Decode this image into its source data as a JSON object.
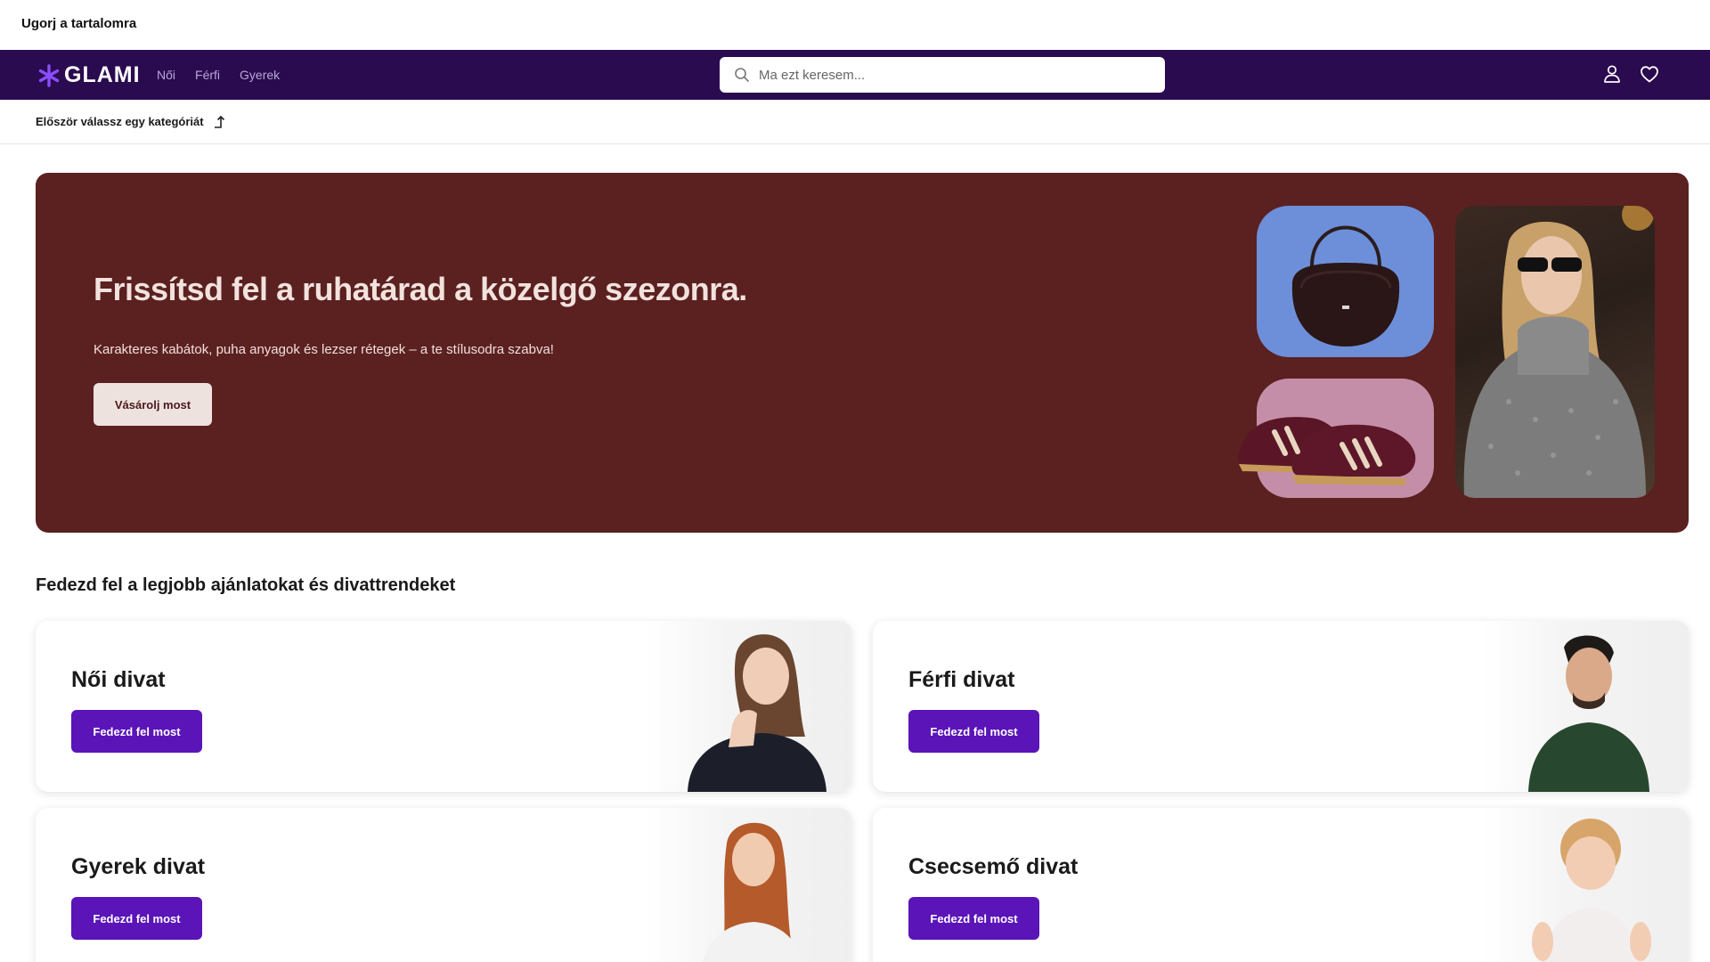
{
  "skip_link": "Ugorj a tartalomra",
  "header": {
    "logo_text": "GLAMI",
    "nav": [
      "Női",
      "Férfi",
      "Gyerek"
    ],
    "search_placeholder": "Ma ezt keresem..."
  },
  "catbar": {
    "label": "Először válassz egy kategóriát"
  },
  "hero": {
    "title": "Frissítsd fel a ruhatárad a közelgő szezonra.",
    "subtitle": "Karakteres kabátok, puha anyagok és lezser rétegek – a te stílusodra szabva!",
    "button": "Vásárolj most"
  },
  "section_title": "Fedezd fel a legjobb ajánlatokat és divattrendeket",
  "cards": [
    {
      "title": "Női divat",
      "button": "Fedezd fel most"
    },
    {
      "title": "Férfi divat",
      "button": "Fedezd fel most"
    },
    {
      "title": "Gyerek divat",
      "button": "Fedezd fel most"
    },
    {
      "title": "Csecsemő divat",
      "button": "Fedezd fel most"
    }
  ],
  "colors": {
    "topbar": "#2a0b4f",
    "hero_bg": "#5b2020",
    "accent": "#5a14b8"
  }
}
